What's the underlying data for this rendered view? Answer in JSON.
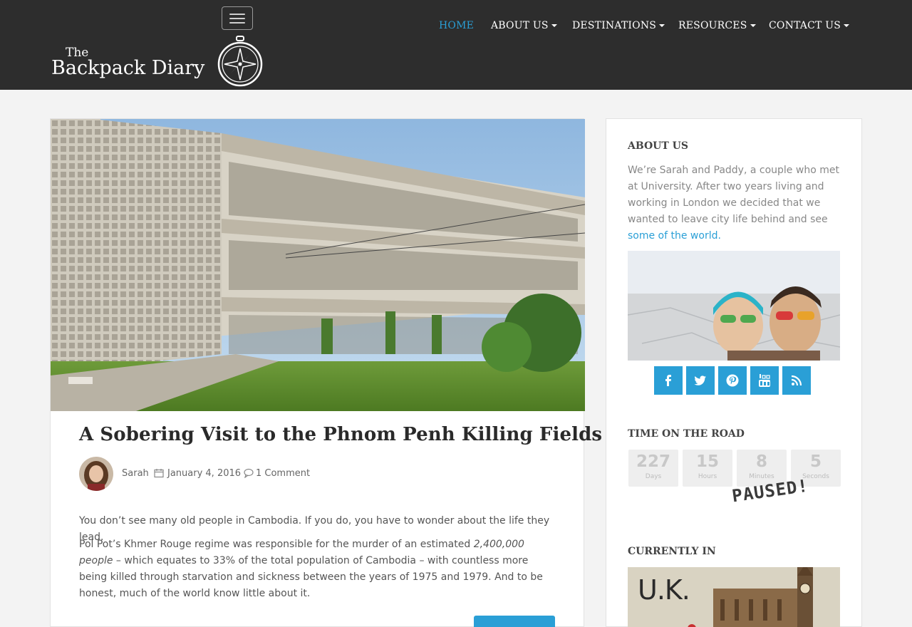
{
  "site": {
    "logo_small": "The",
    "logo_big": "Backpack Diary"
  },
  "nav": {
    "items": [
      {
        "label": "HOME",
        "active": true,
        "dropdown": false
      },
      {
        "label": "ABOUT US",
        "active": false,
        "dropdown": true
      },
      {
        "label": "DESTINATIONS",
        "active": false,
        "dropdown": true
      },
      {
        "label": "RESOURCES",
        "active": false,
        "dropdown": true
      },
      {
        "label": "CONTACT US",
        "active": false,
        "dropdown": true
      }
    ]
  },
  "post": {
    "title": "A Sobering Visit to the Phnom Penh Killing Fields",
    "author": "Sarah",
    "date": "January 4, 2016",
    "comments": "1 Comment",
    "paragraph1": "You don’t see many old people in Cambodia. If you do, you have to wonder about the life they lead.",
    "paragraph2_before": "Pol Pot’s Khmer Rouge regime was responsible for the murder of an estimated ",
    "paragraph2_em": "2,400,000 people",
    "paragraph2_after": " – which equates to 33% of the total population of Cambodia – with countless more being killed through starvation and sickness between the years of 1975 and 1979. And to be honest, much of the world know little about it."
  },
  "sidebar": {
    "about": {
      "title": "ABOUT US",
      "text": "We’re Sarah and Paddy, a couple who met at University. After two years living and working in London we decided that we wanted to leave city life behind and see ",
      "link": "some of the world."
    },
    "social": [
      "facebook-icon",
      "twitter-icon",
      "pinterest-icon",
      "youtube-icon",
      "rss-icon"
    ],
    "time": {
      "title": "TIME ON THE ROAD",
      "counters": [
        {
          "value": "227",
          "label": "Days"
        },
        {
          "value": "15",
          "label": "Hours"
        },
        {
          "value": "8",
          "label": "Minutes"
        },
        {
          "value": "5",
          "label": "Seconds"
        }
      ],
      "stamp": "PAUSED!"
    },
    "current": {
      "title": "CURRENTLY IN",
      "place": "U.K."
    }
  },
  "colors": {
    "accent": "#2a9fd6",
    "header_bg": "#2d2d2d",
    "page_bg": "#f3f3f3"
  }
}
